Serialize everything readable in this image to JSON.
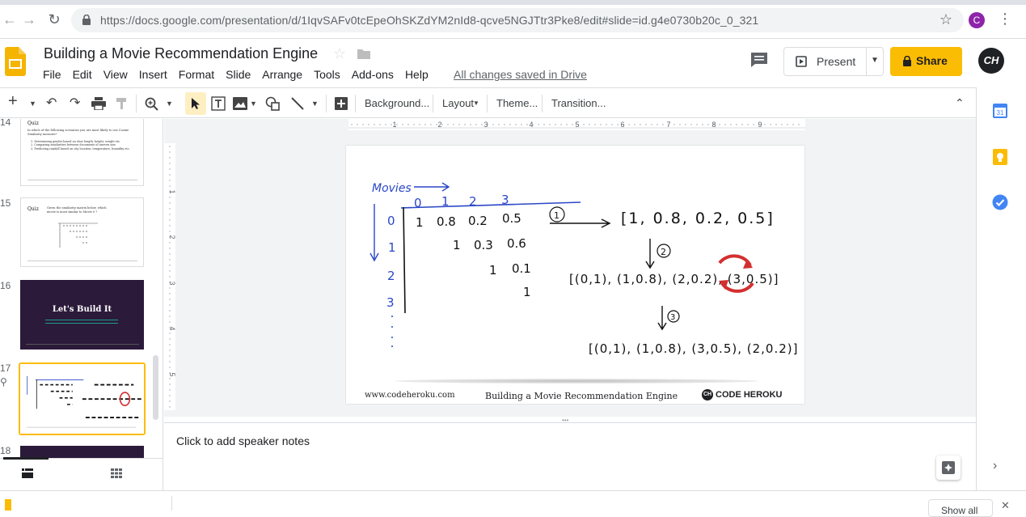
{
  "browser": {
    "url": "https://docs.google.com/presentation/d/1IqvSAFv0tcEpeOhSKZdYM2nId8-qcve5NGJTtr3Pke8/edit#slide=id.g4e0730b20c_0_321",
    "profile_initial": "C"
  },
  "doc": {
    "title": "Building a Movie Recommendation Engine",
    "save_status": "All changes saved in Drive",
    "menu": [
      "File",
      "Edit",
      "View",
      "Insert",
      "Format",
      "Slide",
      "Arrange",
      "Tools",
      "Add-ons",
      "Help"
    ],
    "present_label": "Present",
    "share_label": "Share",
    "avatar_initials": "CH"
  },
  "toolbar": {
    "background": "Background...",
    "layout": "Layout",
    "theme": "Theme...",
    "transition": "Transition..."
  },
  "ruler": {
    "h_ticks": [
      "1",
      "2",
      "3",
      "4",
      "5",
      "6",
      "7",
      "8",
      "9"
    ],
    "v_ticks": [
      "1",
      "2",
      "3",
      "4",
      "5"
    ]
  },
  "filmstrip": {
    "slides": [
      {
        "number": "14",
        "title": "Quiz",
        "body": "In which of the following scenarios you are most likely to use Cosine Similarity measure?",
        "items": [
          "Determining gender based on shoe length, height, weight etc.",
          "Comparing similarities between documents of uneven size",
          "Predicting rainfall based on city location, temperature, humidity etc."
        ]
      },
      {
        "number": "15",
        "title": "Quiz",
        "body": "Given the similarity matrix below, which movie is most similar to Movie 0 ?"
      },
      {
        "number": "16",
        "title": "Let's Build It"
      },
      {
        "number": "17"
      },
      {
        "number": "18"
      }
    ]
  },
  "slide": {
    "handwriting": {
      "movies_label": "Movies",
      "col_headers": [
        "0",
        "1",
        "2",
        "3"
      ],
      "row_headers": [
        "0",
        "1",
        "2",
        "3"
      ],
      "row0": [
        "1",
        "0.8",
        "0.2",
        "0.5"
      ],
      "row1": [
        "1",
        "0.3",
        "0.6"
      ],
      "row2": [
        "1",
        "0.1"
      ],
      "row3": [
        "1"
      ],
      "step1": "1",
      "step2": "2",
      "step3": "3",
      "list1": "[1, 0.8, 0.2, 0.5]",
      "list2": "[(0,1), (1,0.8), (2,0.2), (3,0.5)]",
      "list3": "[(0,1), (1,0.8), (3,0.5), (2,0.2)]"
    },
    "footer_left": "www.codeheroku.com",
    "footer_mid": "Building a Movie Recommendation Engine",
    "footer_logo": "CH",
    "footer_right": "CODE HEROKU"
  },
  "notes": {
    "placeholder": "Click to add speaker notes"
  },
  "downloads": {
    "show_all": "Show all"
  },
  "colors": {
    "share": "#fbbc04",
    "ink_blue": "#2b47c6",
    "ink_black": "#111111",
    "ink_red": "#d32f2f",
    "slide16_bg": "#2b1a3a"
  }
}
